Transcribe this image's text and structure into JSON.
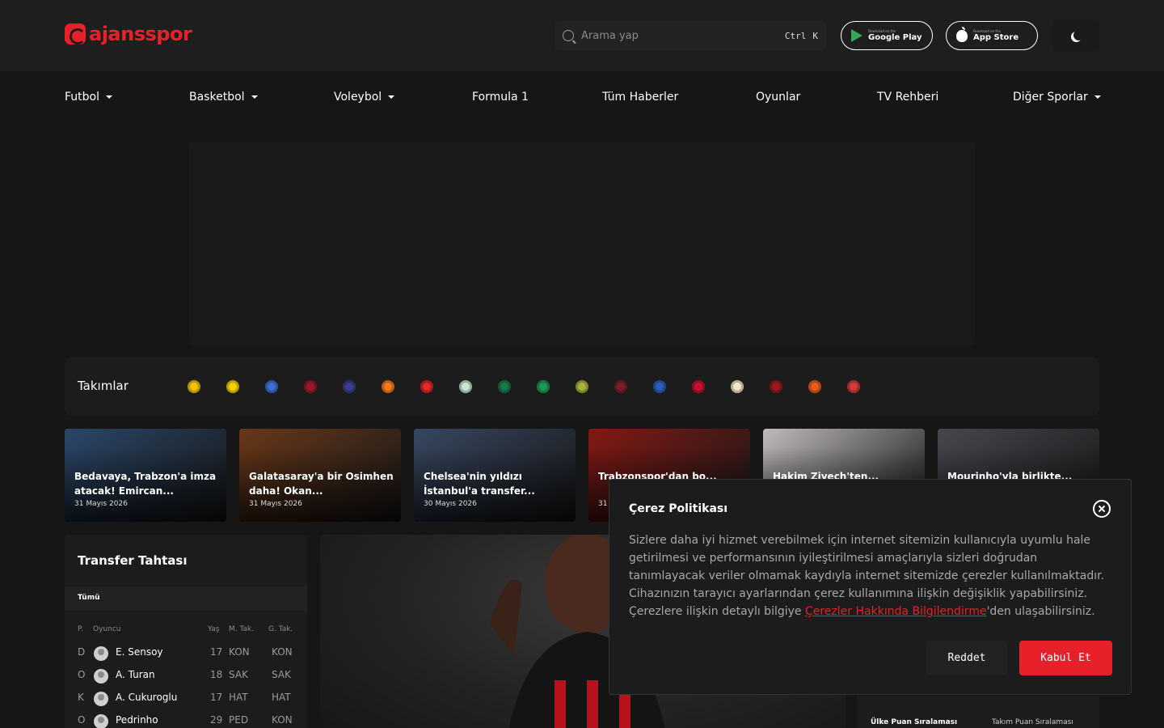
{
  "header": {
    "logo_text": "ajansspor",
    "search": {
      "placeholder": "Arama yap",
      "shortcut_ctrl": "Ctrl",
      "shortcut_key": "K"
    },
    "google_play": {
      "small": "Download on the",
      "label": "Google Play"
    },
    "app_store": {
      "small": "Download on the",
      "label": "App Store"
    },
    "theme_toggle_icon": "moon-icon"
  },
  "nav": {
    "items": [
      {
        "label": "Futbol"
      },
      {
        "label": "Basketbol"
      },
      {
        "label": "Voleybol"
      },
      {
        "label": "Formula 1"
      },
      {
        "label": "Tüm Haberler"
      },
      {
        "label": "Oyunlar"
      },
      {
        "label": "TV Rehberi"
      },
      {
        "label": "Diğer Sporlar"
      }
    ]
  },
  "teams": {
    "title": "Takımlar",
    "badge_colors": [
      "#f2c500",
      "#f2d200",
      "#3b6fd1",
      "#9b1a2a",
      "#3c3c8c",
      "#f47b20",
      "#e1262c",
      "#c9e6d4",
      "#1a7a4a",
      "#1d9a5a",
      "#a6b23a",
      "#7a1f2a",
      "#2a5cb8",
      "#c8102e",
      "#f0e6c8",
      "#9a1a1a",
      "#e85c1a",
      "#d33a3a"
    ]
  },
  "news": [
    {
      "title": "Bedavaya, Trabzon'a imza atacak! Emircan...",
      "date": "31 Mayıs 2026",
      "bg": "#2c4a6e"
    },
    {
      "title": "Galatasaray'a bir Osimhen daha! Okan...",
      "date": "31 Mayıs 2026",
      "bg": "#6e3a1a"
    },
    {
      "title": "Chelsea'nin yıldızı İstanbul'a transfer...",
      "date": "30 Mayıs 2026",
      "bg": "#3a4a66"
    },
    {
      "title": "Trabzonspor'dan bo...",
      "date": "31",
      "bg": "#8a1a14"
    },
    {
      "title": "Hakim Ziyech'ten...",
      "date": "",
      "bg": "#c9c4c4"
    },
    {
      "title": "Mourinho'yla birlikte...",
      "date": "",
      "bg": "#4a4a52"
    }
  ],
  "transfer_board": {
    "title": "Transfer Tahtası",
    "tab": "Tümü",
    "headers": {
      "pos": "P.",
      "player": "Oyuncu",
      "age": "Yaş",
      "from": "M. Tak.",
      "to": "G. Tak."
    },
    "rows": [
      {
        "pos": "D",
        "name": "E. Sensoy",
        "age": "17",
        "from": "KON",
        "to": "KON"
      },
      {
        "pos": "O",
        "name": "A. Turan",
        "age": "18",
        "from": "SAK",
        "to": "SAK"
      },
      {
        "pos": "K",
        "name": "A. Cukuroglu",
        "age": "17",
        "from": "HAT",
        "to": "HAT"
      },
      {
        "pos": "O",
        "name": "Pedrinho",
        "age": "29",
        "from": "PED",
        "to": "KON"
      }
    ]
  },
  "ranking_widget": {
    "tab_country": "Ülke Puan Sıralaması",
    "tab_team": "Takım Puan Sıralaması"
  },
  "cookie": {
    "title": "Çerez Politikası",
    "text_before": "Sizlere daha iyi hizmet verebilmek için internet sitemizin kullanıcıyla uyumlu hale getirilmesi ve performansının iyileştirilmesi amaçlarıyla sizleri doğrudan tanımlayacak veriler olmamak kaydıyla internet sitemizde çerezler kullanılmaktadır. Cihazınızın tarayıcı ayarlarından çerez kullanımına ilişkin değişiklik yapabilirsiniz. Çerezlere ilişkin detaylı bilgiye ",
    "link": "Çerezler Hakkında Bilgilendirme",
    "text_after": "'den ulaşabilirsiniz.",
    "reject": "Reddet",
    "accept": "Kabul Et"
  }
}
